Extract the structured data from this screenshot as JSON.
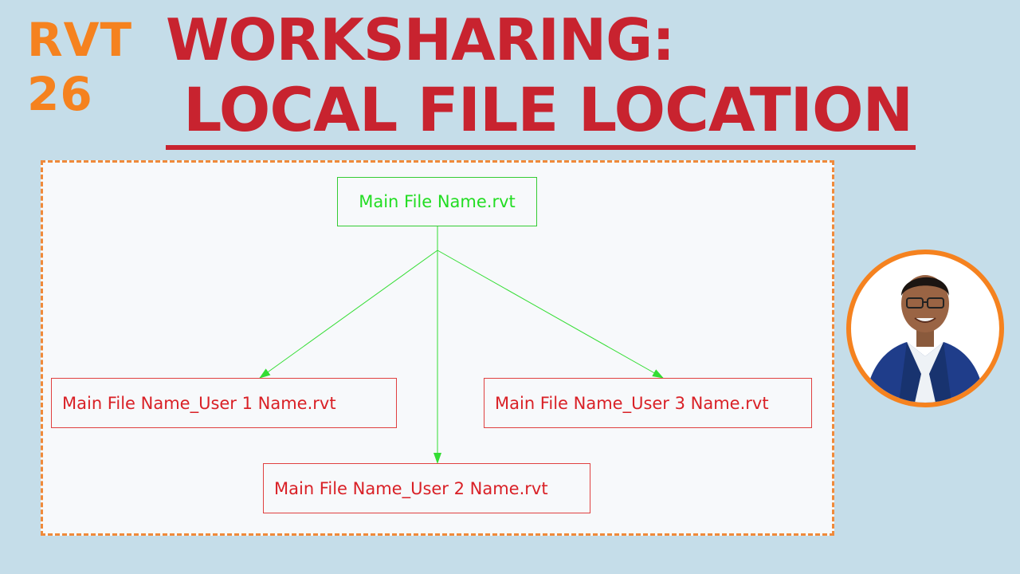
{
  "badge": {
    "line1": "RVT",
    "line2": "26"
  },
  "title": {
    "line1": "WORKSHARING:",
    "line2": "LOCAL FILE LOCATION"
  },
  "diagram": {
    "main_file": "Main File Name.rvt",
    "user_files": [
      "Main File Name_User 1 Name.rvt",
      "Main File Name_User 2 Name.rvt",
      "Main File Name_User 3 Name.rvt"
    ],
    "colors": {
      "main": "#22dd22",
      "user": "#d92026",
      "connector": "#33dd33"
    }
  },
  "presenter": {
    "icon": "presenter-photo"
  }
}
